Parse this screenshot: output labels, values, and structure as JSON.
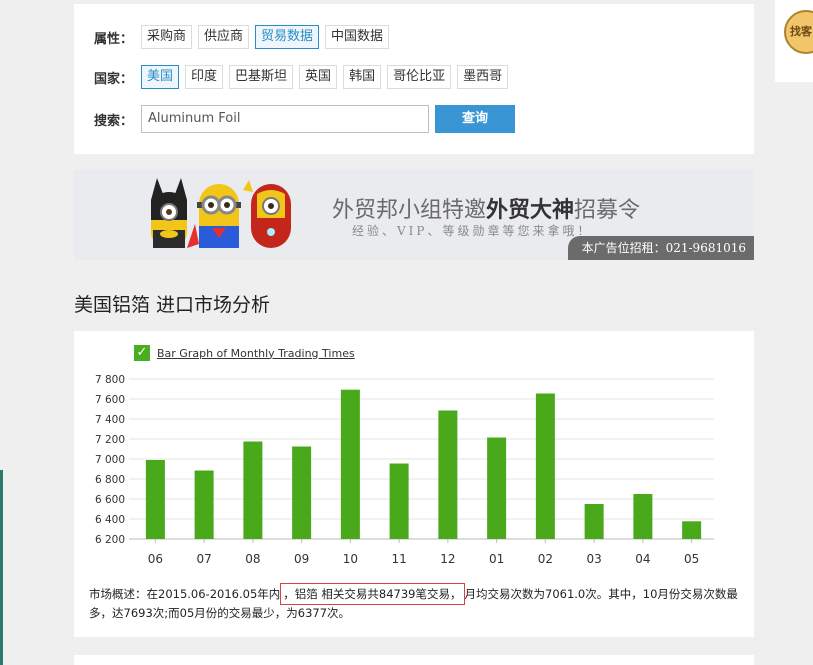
{
  "filters": {
    "attribute_label": "属性：",
    "attributes": [
      "采购商",
      "供应商",
      "贸易数据",
      "中国数据"
    ],
    "attribute_active": 2,
    "country_label": "国家：",
    "countries": [
      "美国",
      "印度",
      "巴基斯坦",
      "英国",
      "韩国",
      "哥伦比亚",
      "墨西哥"
    ],
    "country_active": 0,
    "search_label": "搜索：",
    "search_value": "Aluminum Foil",
    "search_button": "查询"
  },
  "side_logo_text": "找客",
  "banner": {
    "title_pre": "外贸邦小组特邀",
    "title_em": "外贸大神",
    "title_post": "招募令",
    "subtitle": "经验、VIP、等级勋章等您来拿哦！",
    "ad_text": "本广告位招租：021-9681016"
  },
  "section_title": "美国铝箔 进口市场分析",
  "legend_label": "Bar Graph of Monthly Trading Times",
  "colors": {
    "bar": "#4aa81b",
    "accent": "#3a95d5",
    "highlight": "#d94040"
  },
  "chart_data": {
    "type": "bar",
    "categories": [
      "06",
      "07",
      "08",
      "09",
      "10",
      "11",
      "12",
      "01",
      "02",
      "03",
      "04",
      "05"
    ],
    "series": [
      {
        "name": "Bar Graph of Monthly Trading Times",
        "values": [
          6990,
          6885,
          7175,
          7125,
          7693,
          6955,
          7485,
          7215,
          7655,
          6550,
          6650,
          6377
        ]
      }
    ],
    "yticks": [
      "7 800",
      "7 600",
      "7 400",
      "7 200",
      "7 000",
      "6 800",
      "6 600",
      "6 400",
      "6 200"
    ],
    "ylim": [
      6200,
      7800
    ],
    "grid": true
  },
  "summary": {
    "part1": "市场概述：在2015.06-2016.05年内",
    "highlight": "，铝箔 相关交易共84739笔交易，",
    "part2": "月均交易次数为7061.0次。其中，10月份交易次数最多，达7693次;而05月份的交易最少，为6377次。"
  }
}
